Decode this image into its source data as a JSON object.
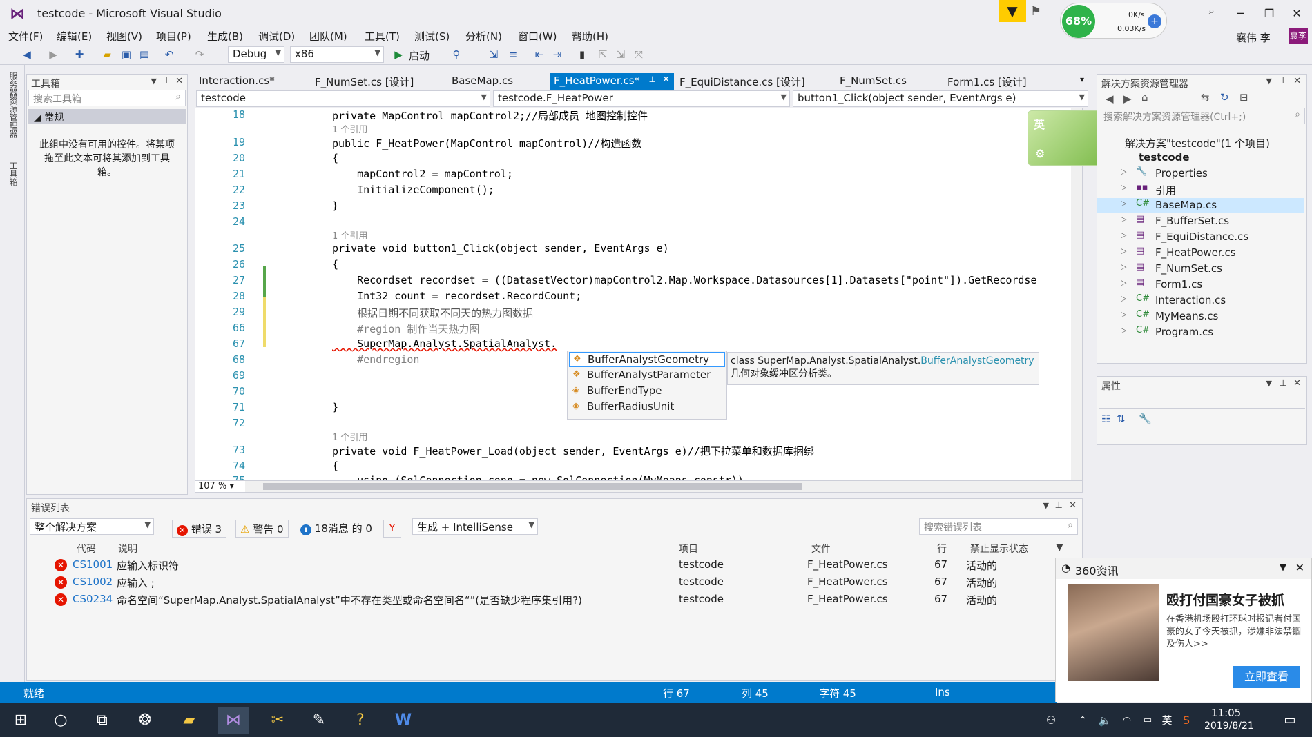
{
  "window": {
    "title": "testcode - Microsoft Visual Studio",
    "user": "襄伟 李",
    "user_initials": "襄李"
  },
  "menu": [
    "文件(F)",
    "编辑(E)",
    "视图(V)",
    "项目(P)",
    "生成(B)",
    "调试(D)",
    "团队(M)",
    "工具(T)",
    "测试(S)",
    "分析(N)",
    "窗口(W)",
    "帮助(H)"
  ],
  "toolbar": {
    "config": "Debug",
    "platform": "x86",
    "start_label": "启动"
  },
  "network": {
    "percent": "68%",
    "up": "0K/s",
    "down": "0.03K/s"
  },
  "left_tabs": [
    "服务器资源管理器",
    "工具箱"
  ],
  "toolbox": {
    "title": "工具箱",
    "search_placeholder": "搜索工具箱",
    "group": "常规",
    "empty_text": "此组中没有可用的控件。将某项拖至此文本可将其添加到工具箱。"
  },
  "editor_tabs": [
    {
      "label": "Interaction.cs*"
    },
    {
      "label": "F_NumSet.cs [设计]"
    },
    {
      "label": "BaseMap.cs"
    },
    {
      "label": "F_HeatPower.cs*",
      "active": true
    },
    {
      "label": "F_EquiDistance.cs [设计]"
    },
    {
      "label": "F_NumSet.cs"
    },
    {
      "label": "Form1.cs [设计]"
    }
  ],
  "nav": {
    "project": "testcode",
    "class": "testcode.F_HeatPower",
    "member": "button1_Click(object sender, EventArgs e)"
  },
  "code": {
    "ref_label": "1 个引用",
    "lines": [
      {
        "n": "18",
        "text": "private MapControl mapControl2;//局部成员 地图控制控件"
      },
      {
        "n": "19",
        "text": "public F_HeatPower(MapControl mapControl)//构造函数"
      },
      {
        "n": "20",
        "text": "{"
      },
      {
        "n": "21",
        "text": "    mapControl2 = mapControl;"
      },
      {
        "n": "22",
        "text": "    InitializeComponent();"
      },
      {
        "n": "23",
        "text": "}"
      },
      {
        "n": "24",
        "text": ""
      },
      {
        "n": "25",
        "text": "private void button1_Click(object sender, EventArgs e)"
      },
      {
        "n": "26",
        "text": "{"
      },
      {
        "n": "27",
        "text": "    Recordset recordset = ((DatasetVector)mapControl2.Map.Workspace.Datasources[1].Datasets[\"point\"]).GetRecordse"
      },
      {
        "n": "28",
        "text": "    Int32 count = recordset.RecordCount;"
      },
      {
        "n": "29",
        "text": "    根据日期不同获取不同天的热力图数据"
      },
      {
        "n": "66",
        "text": "    #region 制作当天热力图"
      },
      {
        "n": "67",
        "text": "    SuperMap.Analyst.SpatialAnalyst."
      },
      {
        "n": "68",
        "text": "    #endregion"
      },
      {
        "n": "69",
        "text": ""
      },
      {
        "n": "70",
        "text": ""
      },
      {
        "n": "71",
        "text": "}"
      },
      {
        "n": "72",
        "text": ""
      },
      {
        "n": "73",
        "text": "private void F_HeatPower_Load(object sender, EventArgs e)//把下拉菜单和数据库捆绑"
      },
      {
        "n": "74",
        "text": "{"
      },
      {
        "n": "75",
        "text": "    using (SqlConnection conn = new SqlConnection(MyMeans.constr))"
      }
    ],
    "zoom": "107 %"
  },
  "autocomplete": {
    "items": [
      "BufferAnalystGeometry",
      "BufferAnalystParameter",
      "BufferEndType",
      "BufferRadiusUnit"
    ],
    "tooltip_prefix": "class SuperMap.Analyst.SpatialAnalyst.",
    "tooltip_class": "BufferAnalystGeometry",
    "tooltip_desc": "几何对象缓冲区分析类。"
  },
  "ime": {
    "label": "英"
  },
  "solution": {
    "title": "解决方案资源管理器",
    "search_placeholder": "搜索解决方案资源管理器(Ctrl+;)",
    "root": "解决方案\"testcode\"(1 个项目)",
    "project": "testcode",
    "items": [
      "Properties",
      "引用",
      "BaseMap.cs",
      "F_BufferSet.cs",
      "F_EquiDistance.cs",
      "F_HeatPower.cs",
      "F_NumSet.cs",
      "Form1.cs",
      "Interaction.cs",
      "MyMeans.cs",
      "Program.cs"
    ]
  },
  "properties": {
    "title": "属性"
  },
  "errors": {
    "title": "错误列表",
    "scope": "整个解决方案",
    "errors_chip": "错误 3",
    "warnings_chip": "警告 0",
    "messages_chip": "18消息 的 0",
    "build_filter": "生成 + IntelliSense",
    "search_placeholder": "搜索错误列表",
    "headers": [
      "代码",
      "说明",
      "项目",
      "文件",
      "行",
      "禁止显示状态"
    ],
    "rows": [
      {
        "code": "CS1001",
        "desc": "应输入标识符",
        "project": "testcode",
        "file": "F_HeatPower.cs",
        "line": "67",
        "state": "活动的"
      },
      {
        "code": "CS1002",
        "desc": "应输入 ;",
        "project": "testcode",
        "file": "F_HeatPower.cs",
        "line": "67",
        "state": "活动的"
      },
      {
        "code": "CS0234",
        "desc": "命名空间“SuperMap.Analyst.SpatialAnalyst”中不存在类型或命名空间名“”(是否缺少程序集引用?)",
        "project": "testcode",
        "file": "F_HeatPower.cs",
        "line": "67",
        "state": "活动的"
      }
    ]
  },
  "status": {
    "ready": "就绪",
    "row": "行 67",
    "col": "列 45",
    "char": "字符 45",
    "mode": "Ins"
  },
  "news": {
    "source": "360资讯",
    "headline": "殴打付国豪女子被抓",
    "body": "在香港机场殴打环球时报记者付国豪的女子今天被抓，涉嫌非法禁锢及伤人>>",
    "button": "立即查看"
  },
  "taskbar": {
    "time": "11:05",
    "date": "2019/8/21",
    "lang": "英"
  }
}
